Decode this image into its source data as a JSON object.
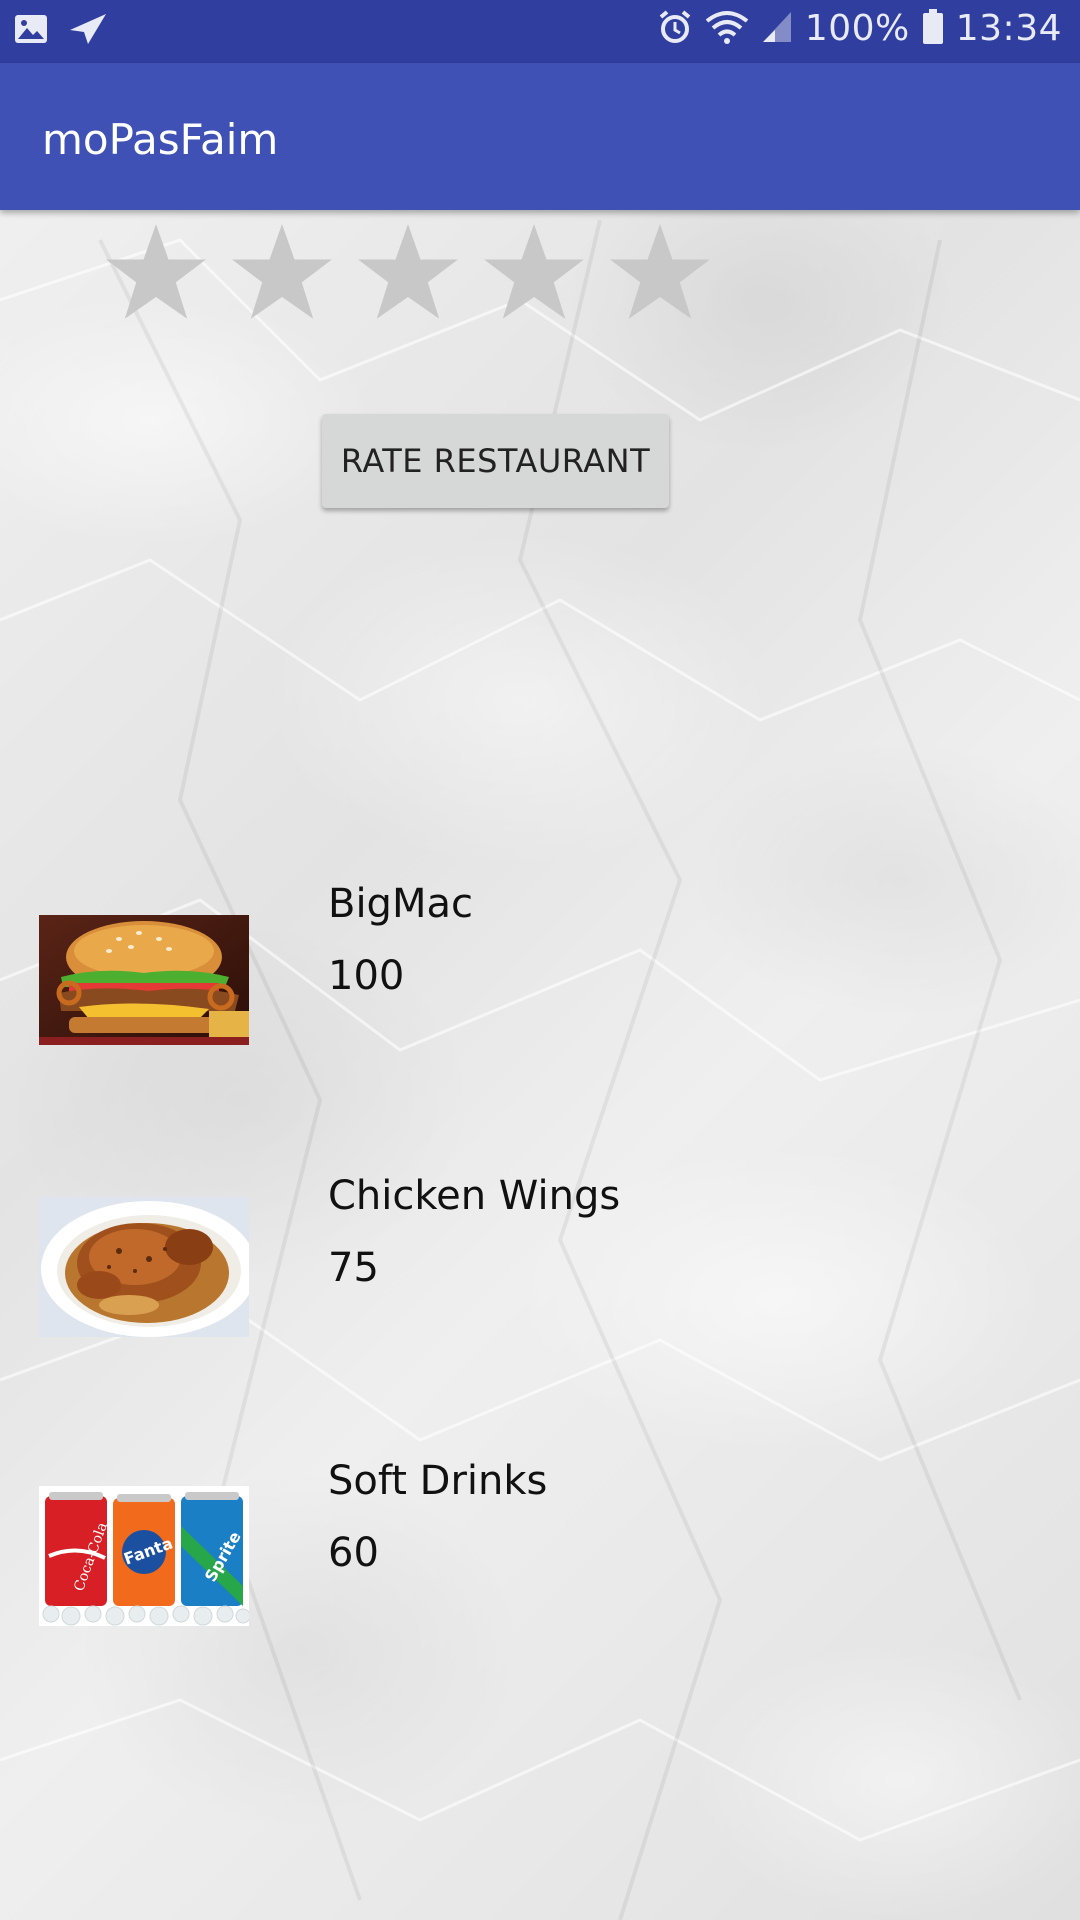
{
  "status_bar": {
    "battery": "100%",
    "time": "13:34",
    "icons": [
      "gallery-icon",
      "send-icon",
      "alarm-icon",
      "wifi-icon",
      "signal-icon",
      "battery-icon"
    ]
  },
  "app_bar": {
    "title": "moPasFaim"
  },
  "rating": {
    "stars_total": 5,
    "stars_filled": 0
  },
  "rate_button": {
    "label": "RATE RESTAURANT"
  },
  "menu": [
    {
      "name": "BigMac",
      "price": "100",
      "image": "burger-image"
    },
    {
      "name": "Chicken Wings",
      "price": "75",
      "image": "roast-chicken-image"
    },
    {
      "name": "Soft Drinks",
      "price": "60",
      "image": "soda-cans-image"
    }
  ],
  "colors": {
    "status_bar": "#303f9f",
    "app_bar": "#3f51b5",
    "star_empty": "#c8c8c8",
    "button_bg": "#d6d7d7"
  }
}
